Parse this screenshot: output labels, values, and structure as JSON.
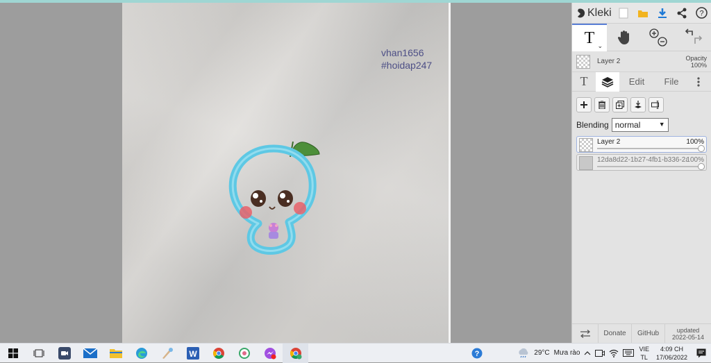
{
  "canvas": {
    "text_line1": "vhan1656",
    "text_line2": "#hoidap247"
  },
  "sidebar": {
    "app_name": "Kleki",
    "header_icons": [
      "new-image-icon",
      "open-folder-icon",
      "download-icon",
      "share-icon",
      "help-icon"
    ],
    "tools": {
      "text_tool": "T",
      "hand_tool": "hand-icon",
      "zoom": "zoom-in-out-icon",
      "undo_redo": "undo-redo-icon"
    },
    "current_layer": {
      "name": "Layer 2",
      "opacity_label": "Opacity",
      "opacity_value": "100%"
    },
    "tabs": [
      {
        "label": "T",
        "icon": "text-tab-icon"
      },
      {
        "label": "",
        "icon": "layers-tab-icon"
      },
      {
        "label": "Edit"
      },
      {
        "label": "File"
      }
    ],
    "layer_buttons": [
      "add-layer",
      "delete-layer",
      "duplicate-layer",
      "merge-down",
      "rename-layer"
    ],
    "blending": {
      "label": "Blending",
      "value": "normal"
    },
    "layers": [
      {
        "name": "Layer 2",
        "opacity": "100%"
      },
      {
        "name": "12da8d22-1b27-4fb1-b336-2a",
        "opacity": "100%"
      }
    ],
    "footer": {
      "donate": "Donate",
      "github": "GitHub",
      "updated_label": "updated",
      "updated_date": "2022-05-14"
    }
  },
  "taskbar": {
    "weather": "29°C",
    "weather_desc": "Mưa rào",
    "lang_top": "VIE",
    "lang_bottom": "TL",
    "time": "4:09 CH",
    "date": "17/06/2022"
  },
  "colors": {
    "canvas_text": "#4d4f86",
    "drawing_outline": "#5ec8e4",
    "leaf": "#4d8f3a",
    "cheeks": "#e8606a"
  }
}
